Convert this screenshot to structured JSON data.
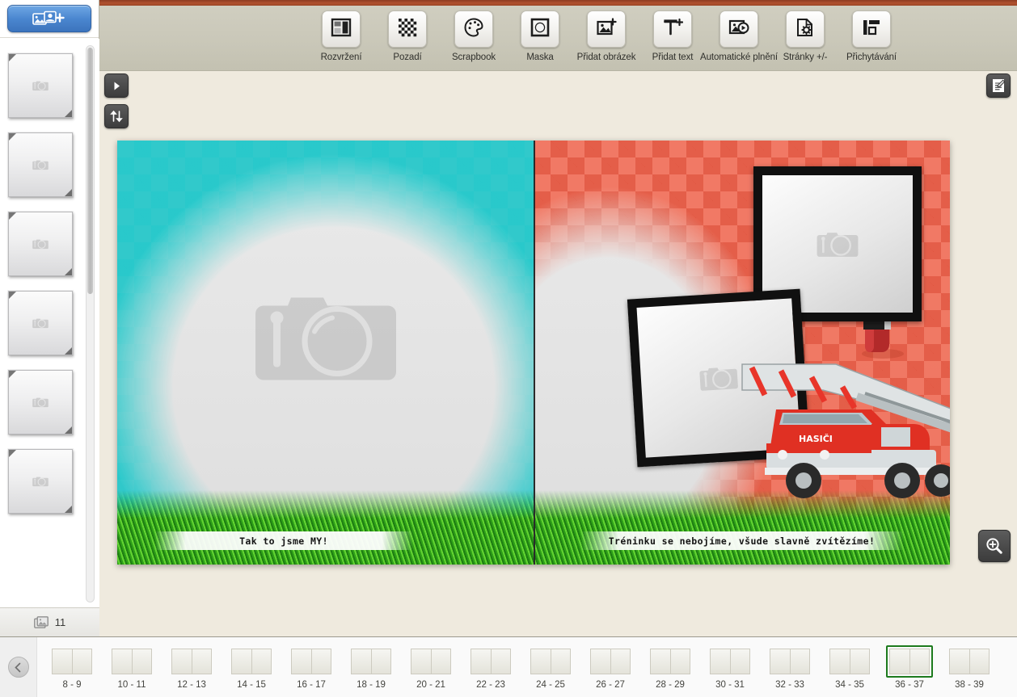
{
  "app": {
    "accent_color": "#a04a28",
    "toolbar_bg": "#cbc9ba",
    "workspace_bg": "#efeade",
    "selection_color": "#1d7a1d"
  },
  "sidebar": {
    "add_photos_icon": "photo-stack-plus-icon",
    "scrollbar": "vertical-scrollbar",
    "photo_count": "11",
    "count_icon": "image-stack-icon",
    "thumbnails": [
      {
        "icon": "camera-placeholder-icon"
      },
      {
        "icon": "camera-placeholder-icon"
      },
      {
        "icon": "camera-placeholder-icon"
      },
      {
        "icon": "camera-placeholder-icon"
      },
      {
        "icon": "camera-placeholder-icon"
      },
      {
        "icon": "camera-placeholder-icon"
      }
    ]
  },
  "toolbar": {
    "tools": [
      {
        "label": "Rozvržení",
        "icon": "layout-icon"
      },
      {
        "label": "Pozadí",
        "icon": "checker-background-icon"
      },
      {
        "label": "Scrapbook",
        "icon": "palette-icon"
      },
      {
        "label": "Maska",
        "icon": "mask-circle-icon"
      },
      {
        "label": "Přidat obrázek",
        "icon": "add-image-icon"
      },
      {
        "label": "Přidat text",
        "icon": "add-text-icon"
      },
      {
        "label": "Automatické plnění",
        "icon": "auto-fill-icon"
      },
      {
        "label": "Stránky +/-",
        "icon": "pages-settings-icon"
      },
      {
        "label": "Přichytávání",
        "icon": "snapping-icon"
      }
    ]
  },
  "workspace": {
    "expand_button_icon": "play-arrow-icon",
    "swap_button_icon": "swap-up-down-icon",
    "notes_button_icon": "note-edit-icon",
    "zoom_button_icon": "zoom-in-icon"
  },
  "canvas": {
    "left_page": {
      "theme": "sky-clouds-grass",
      "border_color": "#22c7c9",
      "caption": "Tak to jsme MY!",
      "placeholder_icon": "camera-placeholder-icon"
    },
    "right_page": {
      "theme": "firefighters-red-check",
      "border_color": "#e8513a",
      "caption": "Tréninku se nebojíme, všude slavně zvítězíme!",
      "truck_label": "HASIČI",
      "stickers": [
        "fire-extinguisher-sticker",
        "fire-truck-sticker"
      ],
      "frames": [
        {
          "name": "photo-frame-top-right",
          "placeholder_icon": "camera-placeholder-icon"
        },
        {
          "name": "photo-frame-bottom-left",
          "placeholder_icon": "camera-placeholder-icon"
        }
      ]
    }
  },
  "page_strip": {
    "prev_icon": "chevron-left-icon",
    "selected": "36 - 37",
    "pages": [
      {
        "label": "8 - 9"
      },
      {
        "label": "10 - 11"
      },
      {
        "label": "12 - 13"
      },
      {
        "label": "14 - 15"
      },
      {
        "label": "16 - 17"
      },
      {
        "label": "18 - 19"
      },
      {
        "label": "20 - 21"
      },
      {
        "label": "22 - 23"
      },
      {
        "label": "24 - 25"
      },
      {
        "label": "26 - 27"
      },
      {
        "label": "28 - 29"
      },
      {
        "label": "30 - 31"
      },
      {
        "label": "32 - 33"
      },
      {
        "label": "34 - 35"
      },
      {
        "label": "36 - 37"
      },
      {
        "label": "38 - 39"
      }
    ]
  }
}
